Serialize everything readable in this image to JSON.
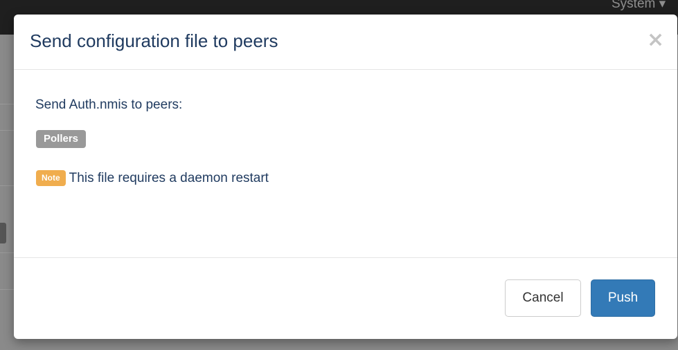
{
  "background": {
    "topbar_menu": "System ▾"
  },
  "modal": {
    "title": "Send configuration file to peers",
    "close_glyph": "×",
    "body": {
      "message": "Send Auth.nmis to peers:",
      "peer_group": "Pollers",
      "note_label": "Note",
      "note_text": "This file requires a daemon restart"
    },
    "footer": {
      "cancel_label": "Cancel",
      "push_label": "Push"
    }
  },
  "colors": {
    "title_text": "#1f3a5f",
    "peer_label_bg": "#999999",
    "note_label_bg": "#f0ad4e",
    "primary_button": "#337ab7"
  },
  "icons": {
    "close": "close-icon"
  }
}
